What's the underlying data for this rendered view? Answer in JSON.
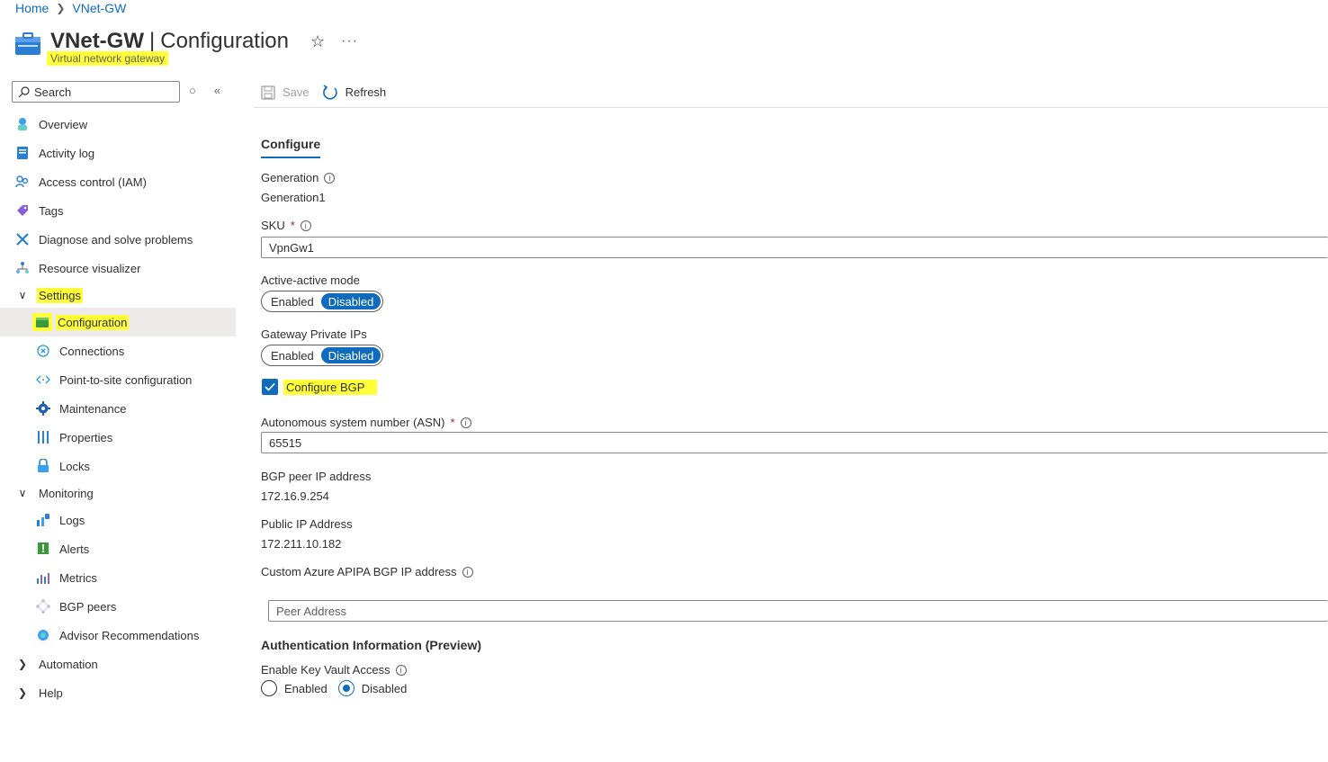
{
  "breadcrumb": {
    "home": "Home",
    "resource": "VNet-GW"
  },
  "header": {
    "name": "VNet-GW",
    "page": "Configuration",
    "subtitle": "Virtual network gateway"
  },
  "search": {
    "placeholder": "Search"
  },
  "sidebar": {
    "items": [
      {
        "label": "Overview"
      },
      {
        "label": "Activity log"
      },
      {
        "label": "Access control (IAM)"
      },
      {
        "label": "Tags"
      },
      {
        "label": "Diagnose and solve problems"
      },
      {
        "label": "Resource visualizer"
      },
      {
        "label": "Settings"
      },
      {
        "label": "Configuration"
      },
      {
        "label": "Connections"
      },
      {
        "label": "Point-to-site configuration"
      },
      {
        "label": "Maintenance"
      },
      {
        "label": "Properties"
      },
      {
        "label": "Locks"
      },
      {
        "label": "Monitoring"
      },
      {
        "label": "Logs"
      },
      {
        "label": "Alerts"
      },
      {
        "label": "Metrics"
      },
      {
        "label": "BGP peers"
      },
      {
        "label": "Advisor Recommendations"
      },
      {
        "label": "Automation"
      },
      {
        "label": "Help"
      }
    ]
  },
  "toolbar": {
    "save": "Save",
    "refresh": "Refresh"
  },
  "tab": "Configure",
  "form": {
    "generation_label": "Generation",
    "generation_value": "Generation1",
    "sku_label": "SKU",
    "sku_value": "VpnGw1",
    "active_active_label": "Active-active mode",
    "gateway_private_label": "Gateway Private IPs",
    "enabled": "Enabled",
    "disabled": "Disabled",
    "configure_bgp": "Configure BGP",
    "asn_label": "Autonomous system number (ASN)",
    "asn_value": "65515",
    "bgp_peer_label": "BGP peer IP address",
    "bgp_peer_value": "172.16.9.254",
    "public_ip_label": "Public IP Address",
    "public_ip_value": "172.211.10.182",
    "apipa_label": "Custom Azure APIPA BGP IP address",
    "peer_placeholder": "Peer Address",
    "auth_title": "Authentication Information (Preview)",
    "keyvault_label": "Enable Key Vault Access",
    "required_mark": "*"
  },
  "colors": {
    "accent": "#0f6cbd",
    "highlight": "#ffff3a"
  }
}
